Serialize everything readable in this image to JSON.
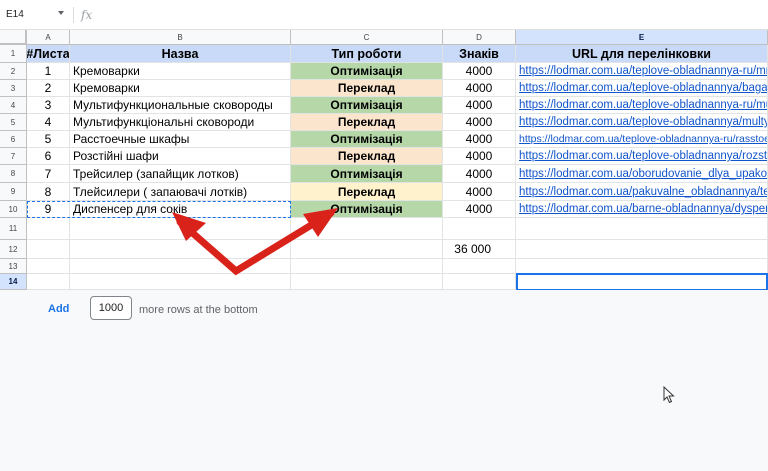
{
  "namebox": "E14",
  "formula_icon": "fx",
  "columns": [
    "A",
    "B",
    "C",
    "D",
    "E"
  ],
  "rows": [
    "1",
    "2",
    "3",
    "4",
    "5",
    "6",
    "7",
    "8",
    "9",
    "10",
    "11",
    "12",
    "13",
    "14"
  ],
  "header": {
    "num": "#Листа",
    "name": "Назва",
    "type": "Тип роботи",
    "chars": "Знаків",
    "url": "URL для перелінковки"
  },
  "items": [
    {
      "num": "1",
      "name": "Кремоварки",
      "type": "Оптимізація",
      "chars": "4000",
      "url": "https://lodmar.com.ua/teplove-obladnannya-ru/mnogofunkcionalnye",
      "color": "#b6d7a8"
    },
    {
      "num": "2",
      "name": "Кремоварки",
      "type": "Переклад",
      "chars": "4000",
      "url": "https://lodmar.com.ua/teplove-obladnannya/bagatofunktsionalni",
      "color": "#fce5cd"
    },
    {
      "num": "3",
      "name": "Мультифункциональные сковороды",
      "type": "Оптимізація",
      "chars": "4000",
      "url": "https://lodmar.com.ua/teplove-obladnannya-ru/multifunkcionalnye",
      "color": "#b6d7a8"
    },
    {
      "num": "4",
      "name": "Мультифункціональні сковороди",
      "type": "Переклад",
      "chars": "4000",
      "url": "https://lodmar.com.ua/teplove-obladnannya/multyfunktsionalni",
      "color": "#fce5cd"
    },
    {
      "num": "5",
      "name": "Расстоечные шкафы",
      "type": "Оптимізація",
      "chars": "4000",
      "url": "https://lodmar.com.ua/teplove-obladnannya-ru/rasstoechnye",
      "color": "#b6d7a8"
    },
    {
      "num": "6",
      "name": "Розстійні шафи",
      "type": "Переклад",
      "chars": "4000",
      "url": "https://lodmar.com.ua/teplove-obladnannya/rozstijni_shafy",
      "color": "#fce5cd"
    },
    {
      "num": "7",
      "name": "Трейсилер (запайщик лотков)",
      "type": "Оптимізація",
      "chars": "4000",
      "url": "https://lodmar.com.ua/oborudovanie_dlya_upakovki/trejsilery",
      "color": "#b6d7a8"
    },
    {
      "num": "8",
      "name": "Тлейсилери ( запаювачі лотків)",
      "type": "Переклад",
      "chars": "4000",
      "url": "https://lodmar.com.ua/pakuvalne_obladnannya/termozapaiuvachi",
      "color": "#fff2cc"
    },
    {
      "num": "9",
      "name": "Диспенсер для соків",
      "type": "Оптимізація",
      "chars": "4000",
      "url": "https://lodmar.com.ua/barne-obladnannya/dyspensery",
      "color": "#b6d7a8"
    }
  ],
  "total": "36 000",
  "add": {
    "label": "Add",
    "count": "1000",
    "suffix": "more rows at the bottom"
  },
  "annotation_color": "#d9231a"
}
